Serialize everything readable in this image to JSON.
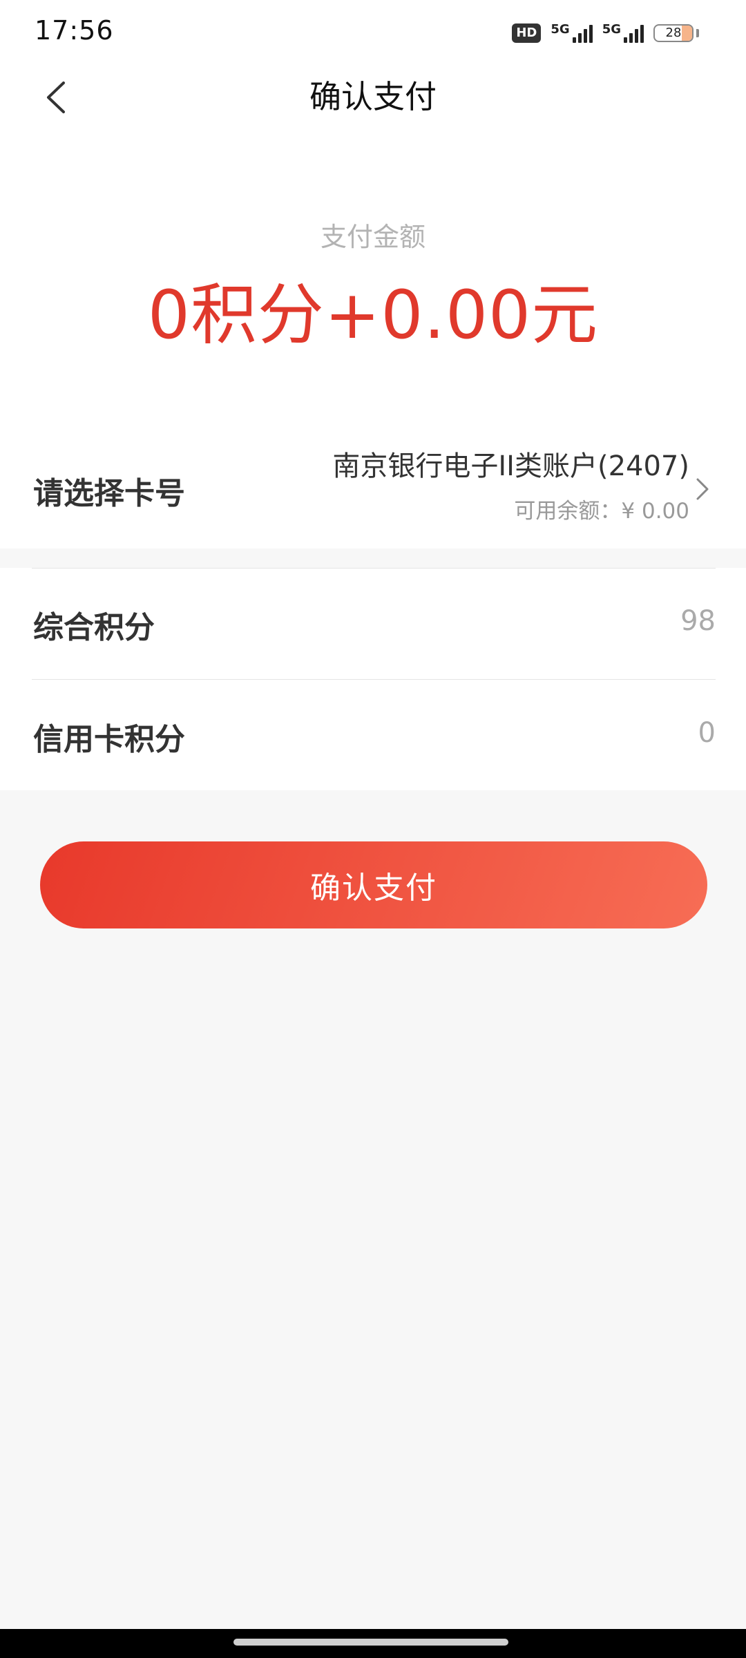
{
  "status_bar": {
    "time": "17:56",
    "hd_badge": "HD",
    "network_1": "5G",
    "network_2": "5G",
    "battery_level": "28",
    "battery_fraction": 0.28
  },
  "header": {
    "title": "确认支付",
    "back_icon": "chevron-left-icon"
  },
  "amount": {
    "label": "支付金额",
    "value": "0积分+0.00元",
    "color": "#e0392c"
  },
  "card": {
    "label": "请选择卡号",
    "name": "南京银行电子II类账户(2407)",
    "balance": "可用余额：¥ 0.00",
    "chevron_icon": "chevron-right-icon"
  },
  "points": [
    {
      "label": "综合积分",
      "value": "98"
    },
    {
      "label": "信用卡积分",
      "value": "0"
    }
  ],
  "confirm_button": {
    "label": "确认支付",
    "gradient_start": "#e8392b",
    "gradient_end": "#f76d55"
  }
}
